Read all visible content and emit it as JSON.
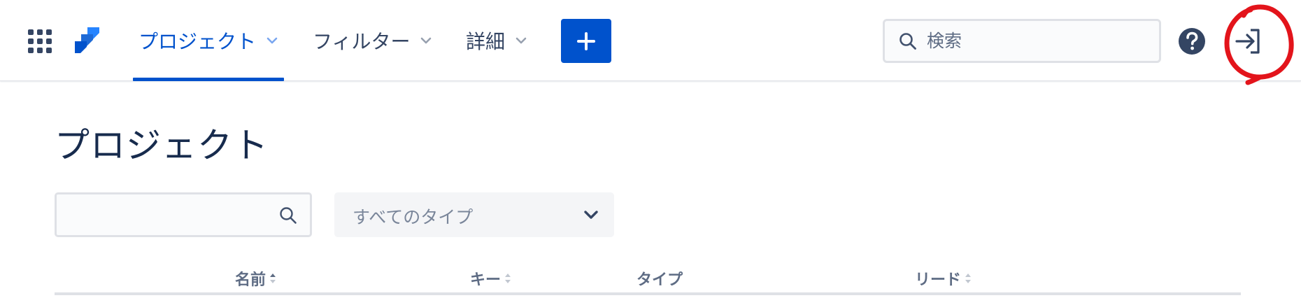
{
  "nav": {
    "items": [
      {
        "label": "プロジェクト"
      },
      {
        "label": "フィルター"
      },
      {
        "label": "詳細"
      }
    ],
    "create_label": "+",
    "search_placeholder": "検索",
    "icons": [
      "app-switcher-icon",
      "jira-logo-icon",
      "chevron-down-icon",
      "plus-icon",
      "search-icon",
      "help-icon",
      "login-icon"
    ]
  },
  "page": {
    "title": "プロジェクト",
    "filter_input_value": "",
    "type_select_value": "すべてのタイプ"
  },
  "table": {
    "columns": [
      {
        "label": "名前",
        "sorted": true
      },
      {
        "label": "キー",
        "sorted": false
      },
      {
        "label": "タイプ",
        "sorted": false
      },
      {
        "label": "リード",
        "sorted": false
      }
    ]
  },
  "colors": {
    "accent": "#0052cc",
    "text": "#172b4d",
    "muted": "#5e6c84",
    "annotation": "#e3141b"
  }
}
